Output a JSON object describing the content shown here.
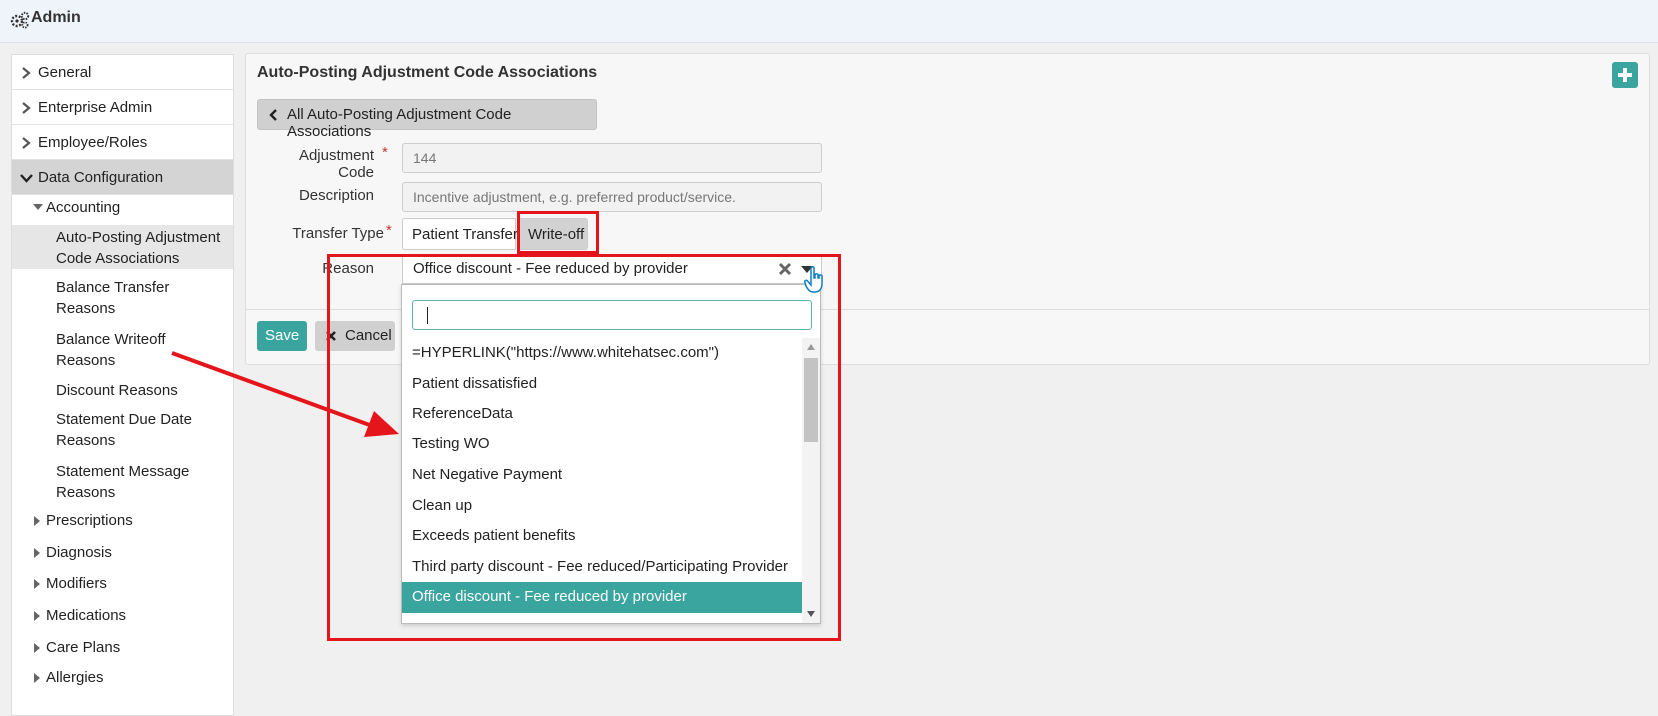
{
  "header": {
    "title": "Admin",
    "icon": "gears-icon"
  },
  "sidebar": {
    "top_items": [
      {
        "label": "General",
        "expanded": false
      },
      {
        "label": "Enterprise Admin",
        "expanded": false
      },
      {
        "label": "Employee/Roles",
        "expanded": false
      },
      {
        "label": "Data Configuration",
        "expanded": true
      }
    ],
    "accounting": {
      "label": "Accounting",
      "items": [
        {
          "label": "Auto-Posting Adjustment Code Associations",
          "active": true
        },
        {
          "label": "Balance Transfer Reasons"
        },
        {
          "label": "Balance Writeoff Reasons"
        },
        {
          "label": "Discount Reasons"
        },
        {
          "label": "Statement Due Date Reasons"
        },
        {
          "label": "Statement Message Reasons"
        }
      ]
    },
    "sections": [
      "Prescriptions",
      "Diagnosis",
      "Modifiers",
      "Medications",
      "Care Plans",
      "Allergies"
    ]
  },
  "main": {
    "title": "Auto-Posting Adjustment Code Associations",
    "back_label": "All Auto-Posting Adjustment Code Associations",
    "fields": {
      "adjustment_code": {
        "label": "Adjustment Code",
        "required_mark": "*",
        "value": "144"
      },
      "description": {
        "label": "Description",
        "value": "Incentive adjustment, e.g. preferred product/service."
      },
      "transfer_type": {
        "label": "Transfer Type",
        "required_mark": "*",
        "options": [
          "Patient Transfer",
          "Write-off"
        ],
        "selected": "Write-off"
      },
      "reason": {
        "label": "Reason",
        "value": "Office discount - Fee reduced by provider"
      }
    },
    "save_label": "Save",
    "cancel_label": "Cancel"
  },
  "dropdown": {
    "search_value": "",
    "options": [
      "=HYPERLINK(\"https://www.whitehatsec.com\")",
      "Patient dissatisfied",
      "ReferenceData",
      "Testing WO",
      "Net Negative Payment",
      "Clean up",
      "Exceeds patient benefits",
      "Third party discount - Fee reduced/Participating Provider",
      "Office discount - Fee reduced by provider"
    ],
    "selected": "Office discount - Fee reduced by provider"
  },
  "colors": {
    "accent": "#3aa59f",
    "annotation": "#e5161b",
    "header_bg": "#eef4f9"
  }
}
